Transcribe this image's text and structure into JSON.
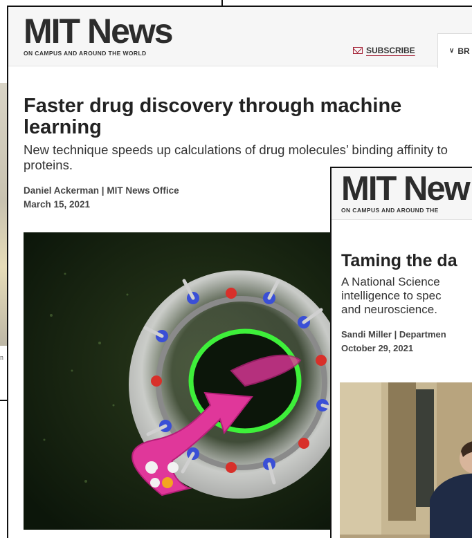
{
  "main_article": {
    "logo": "MIT News",
    "tagline": "ON CAMPUS AND AROUND THE WORLD",
    "subscribe_label": "SUBSCRIBE",
    "browse_label": "BR",
    "headline": "Faster drug discovery through machine learning",
    "dek": "New technique speeds up calculations of drug molecules’ binding affinity to proteins.",
    "author": "Daniel Ackerman | MIT News Office",
    "date": "March 15, 2021",
    "image_icon": "molecule-image"
  },
  "overlay_article": {
    "logo": "MIT New",
    "tagline": "ON CAMPUS AND AROUND THE",
    "headline": "Taming the da",
    "dek_line1": "A National Science",
    "dek_line2": "intelligence to spec",
    "dek_line3": "and neuroscience.",
    "author": "Sandi Miller | Departmen",
    "date": "October 29, 2021",
    "image_icon": "portrait-photo"
  },
  "background_article": {
    "caption_fragment": "n"
  },
  "colors": {
    "accent": "#a31f34",
    "header_bg": "#f6f6f6",
    "magenta_ribbon": "#e0379a",
    "green_ring": "#3ef03a"
  }
}
